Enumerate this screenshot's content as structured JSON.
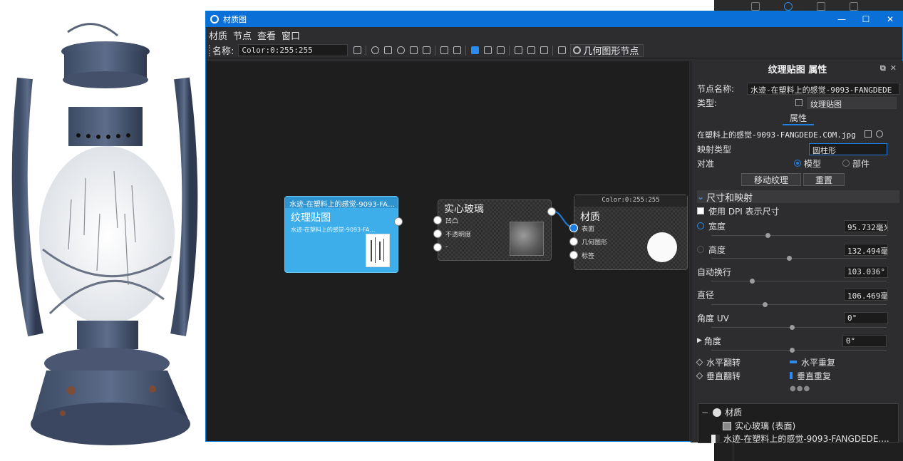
{
  "window": {
    "title": "材质图"
  },
  "menu": [
    "材质",
    "节点",
    "查看",
    "窗口"
  ],
  "toolbar": {
    "name_label": "名称:",
    "name_value": "Color:0:255:255",
    "geometry_node_button": "几何图形节点"
  },
  "nodes": {
    "texture": {
      "header": "水迹-在塑料上的感觉-9093-FA…",
      "title": "纹理贴图",
      "subtitle": "水迹-在塑料上的感觉-9093-FA…"
    },
    "glass": {
      "title": "实心玻璃",
      "ports": [
        "凹凸",
        "不透明度",
        "-"
      ]
    },
    "material": {
      "header": "Color:0:255:255",
      "title": "材质",
      "ports": [
        "表面",
        "几何图形",
        "标签"
      ]
    }
  },
  "properties": {
    "panel_title": "纹理贴图 属性",
    "node_name_label": "节点名称:",
    "node_name_value": "水迹-在塑料上的感觉-9093-FANGDEDE",
    "type_label": "类型:",
    "type_value": "纹理贴图",
    "tab_label": "属性",
    "file_value": "在塑料上的感觉-9093-FANGDEDE.COM.jpg",
    "mapping_type_label": "映射类型",
    "mapping_type_value": "圆柱形",
    "align_label": "对准",
    "align_model": "模型",
    "align_part": "部件",
    "move_texture_button": "移动纹理",
    "reset_button": "重置",
    "section_size": "尺寸和映射",
    "dpi_label": "使用 DPI 表示尺寸",
    "width_label": "宽度",
    "width_value": "95.732毫米",
    "height_label": "高度",
    "height_value": "132.494毫米",
    "wrap_label": "自动换行",
    "wrap_value": "103.036°",
    "diameter_label": "直径",
    "diameter_value": "106.469毫米",
    "angle_uv_label": "角度 UV",
    "angle_uv_value": "0°",
    "angle_label": "角度",
    "angle_value": "0°",
    "flip_h": "水平翻转",
    "repeat_h": "水平重复",
    "flip_v": "垂直翻转",
    "repeat_v": "垂直重复"
  },
  "tree": {
    "root": "材质",
    "child1": "实心玻璃 (表面)",
    "child2": "水迹-在塑料上的感觉-9093-FANGDEDE...."
  },
  "colors": {
    "accent": "#0a6fd6",
    "texture_node": "#3daee9",
    "canvas": "#1e1e1e",
    "panel": "#2d2d30"
  }
}
